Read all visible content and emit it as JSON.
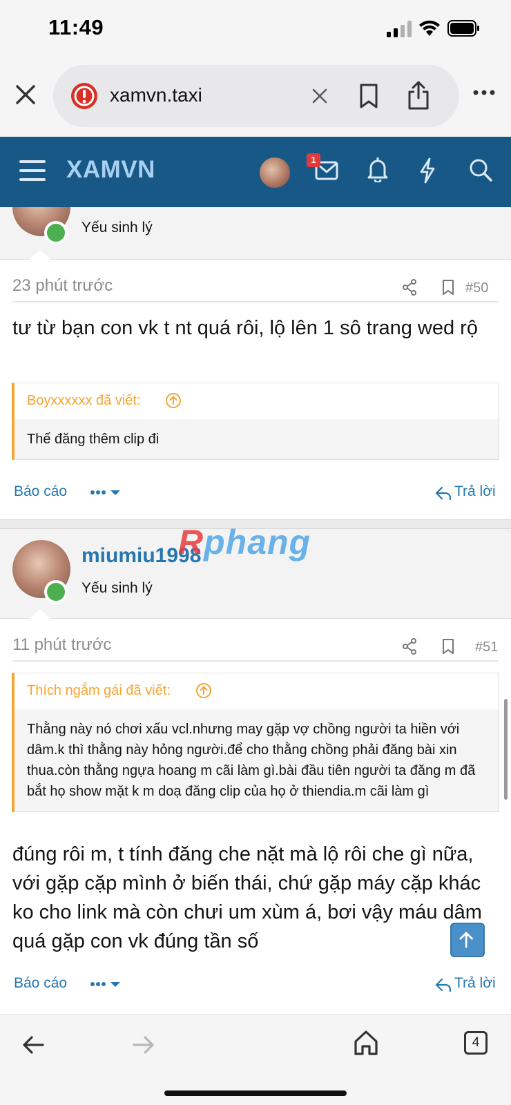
{
  "status_bar": {
    "time": "11:49"
  },
  "browser": {
    "url": "xamvn.taxi"
  },
  "site": {
    "logo": "XAMVN",
    "mail_badge": "1"
  },
  "posts": [
    {
      "user_title": "Yếu sinh lý",
      "time": "23 phút trước",
      "number": "#50",
      "body": "tư từ bạn con vk t nt quá rôi, lộ lên 1 sô trang wed rộ",
      "quote_author": "Boyxxxxxx đã viết:",
      "quote_text": "Thế đăng thêm clip đi",
      "report": "Báo cáo",
      "reply": "Trả lời"
    },
    {
      "username": "miumiu1998",
      "user_title": "Yếu sinh lý",
      "time": "11 phút trước",
      "number": "#51",
      "quote_author": "Thích ngắm gái đã viết:",
      "quote_text": "Thằng này nó chơi xấu vcl.nhưng may gặp vợ chồng người ta hiền với dâm.k thì thằng này hỏng người.để cho thằng chồng phải đăng bài xin thua.còn thằng ngựa hoang m cãi làm gì.bài đầu tiên người ta đăng m đã bắt họ show mặt k m doạ đăng clip của họ ở thiendia.m cãi làm gì",
      "body": "đúng rôi m, t tính đăng che nặt mà lộ rôi che gì nữa, với gặp cặp mình ở biến thái, chứ gặp máy cặp khác ko cho link mà còn chưi um xùm á, bơi vậy máu dâm quá gặp con vk đúng tần số",
      "report": "Báo cáo",
      "reply": "Trả lời"
    }
  ],
  "watermark": {
    "part1": "R",
    "part2": "phang"
  },
  "toolbar": {
    "tab_count": "4"
  },
  "colors": {
    "header": "#185886",
    "link": "#2577b1",
    "quote_accent": "#f7a531",
    "online": "#4caf50"
  }
}
